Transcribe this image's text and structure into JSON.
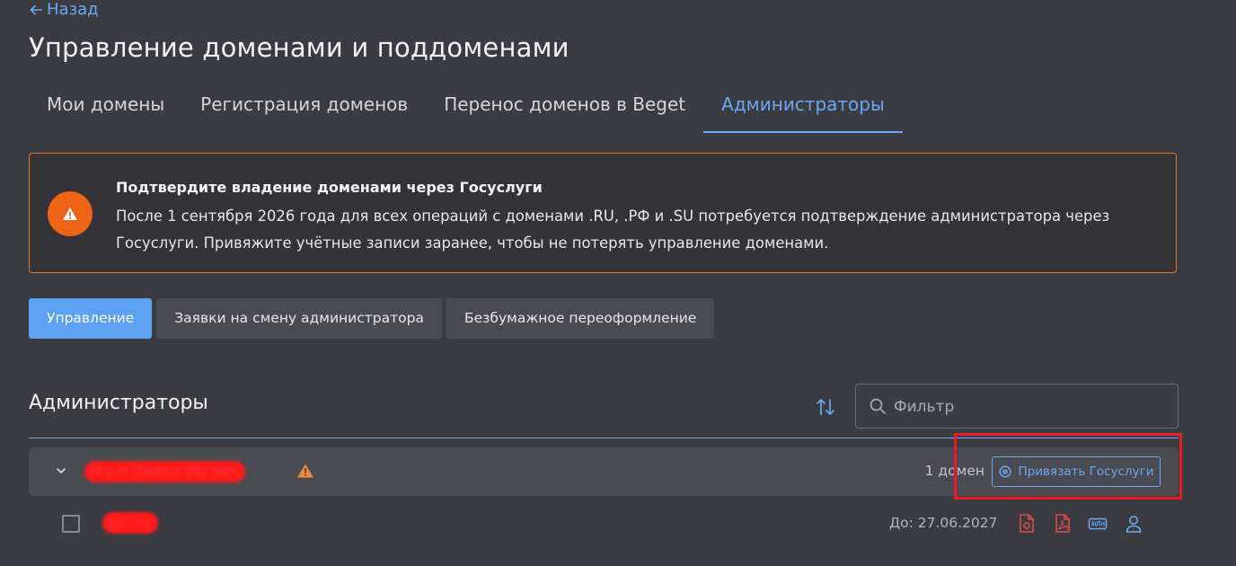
{
  "header": {
    "back_label": "Назад",
    "title": "Управление доменами и поддоменами"
  },
  "tabs": [
    {
      "label": "Мои домены",
      "active": false
    },
    {
      "label": "Регистрация доменов",
      "active": false
    },
    {
      "label": "Перенос доменов в Beget",
      "active": false
    },
    {
      "label": "Администраторы",
      "active": true
    }
  ],
  "alert": {
    "title": "Подтвердите владение доменами через Госуслуги",
    "text": "После 1 сентября 2026 года для всех операций с доменами .RU, .РФ и .SU потребуется подтверждение администратора через Госуслуги. Привяжите учётные записи заранее, чтобы не потерять управление доменами.",
    "accent_color": "#ee6316"
  },
  "subtabs": [
    {
      "label": "Управление",
      "active": true
    },
    {
      "label": "Заявки на смену администратора",
      "active": false
    },
    {
      "label": "Безбумажное переоформление",
      "active": false
    }
  ],
  "section": {
    "title": "Администраторы",
    "filter_placeholder": "Фильтр"
  },
  "admin_group": {
    "name": "Ма   н Павел Ир   вич",
    "domain_count": "1 домен",
    "gosuslugi_button": "Привязать Госуслуги"
  },
  "domain_row": {
    "domain": "be    .ru",
    "expiry": "До: 27.06.2027",
    "icons": [
      "pdf-document-icon",
      "pdf-file-icon",
      "auth-icon",
      "user-icon"
    ]
  },
  "colors": {
    "background": "#3b3c41",
    "accent_blue": "#6aa8f5",
    "warning_orange": "#ee6316",
    "file_icon_red": "#e24a4a",
    "highlight_red": "#e81c24"
  }
}
